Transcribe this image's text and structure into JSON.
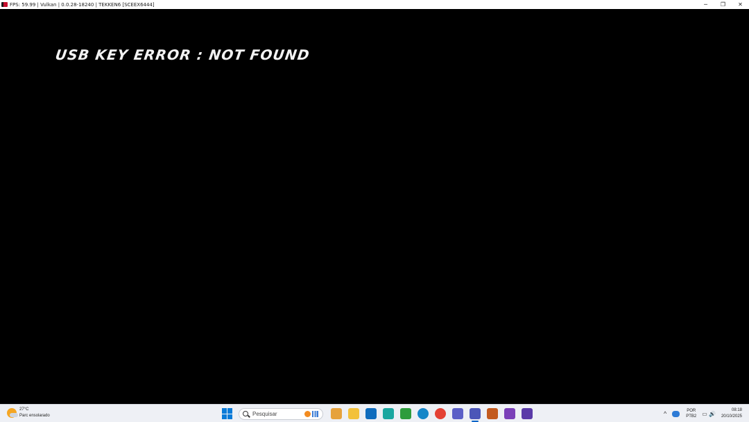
{
  "window": {
    "title": "FPS: 59.99 | Vulkan | 0.0.28-18240 | TEKKEN6 [SCEEX6444]",
    "controls": {
      "minimize": "─",
      "restore": "❐",
      "close": "✕"
    }
  },
  "game": {
    "message": "USB KEY ERROR : NOT FOUND"
  },
  "taskbar": {
    "weather": {
      "temp": "27°C",
      "condition": "Parc ensolarado"
    },
    "search": {
      "placeholder": "Pesquisar"
    },
    "apps": [
      {
        "name": "widgets",
        "color": "#e6a23c"
      },
      {
        "name": "file-explorer",
        "color": "#f3c13a"
      },
      {
        "name": "outlook",
        "color": "#0f6cbd"
      },
      {
        "name": "copilot",
        "color": "#1aa7a0"
      },
      {
        "name": "apps-launcher",
        "color": "#2d9c3c"
      },
      {
        "name": "edge",
        "color": "#1486c8"
      },
      {
        "name": "chrome",
        "color": "#e44134"
      },
      {
        "name": "teams",
        "color": "#5b5fc7"
      },
      {
        "name": "emulator",
        "color": "#4b56b8"
      },
      {
        "name": "tekken",
        "color": "#c35a1e"
      },
      {
        "name": "game-app",
        "color": "#7a3fb8"
      },
      {
        "name": "game-app-2",
        "color": "#5a3aa8"
      }
    ],
    "tray": {
      "chevron": "^",
      "lang_top": "POR",
      "lang_bottom": "PTB2",
      "system_icons": "▭ 🔊",
      "time": "08:18",
      "date": "20/10/2025"
    }
  }
}
